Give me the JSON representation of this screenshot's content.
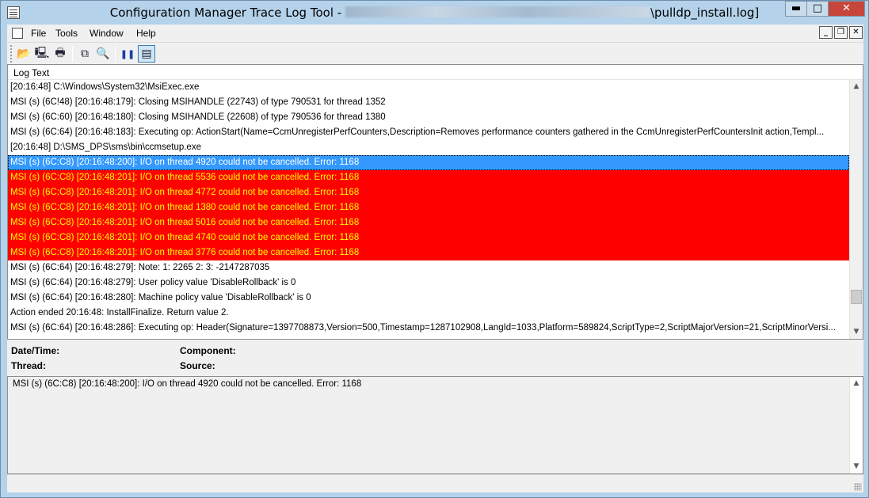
{
  "window": {
    "title_prefix": "Configuration Manager Trace Log Tool - ",
    "title_suffix": "\\pulldp_install.log]",
    "minimize": "▬",
    "maximize": "□",
    "close": "✕"
  },
  "menu": {
    "items": [
      "File",
      "Tools",
      "Window",
      "Help"
    ],
    "mdi_minimize": "_",
    "mdi_restore": "❐",
    "mdi_close": "✕"
  },
  "toolbar": {
    "open": "📂",
    "print_preview": "🖳",
    "print": "🖶",
    "copy": "⧉",
    "find": "🔍",
    "pause": "❚❚",
    "view": "▤"
  },
  "log": {
    "header": "Log Text",
    "rows": [
      {
        "text": "[20:16:48] C:\\Windows\\System32\\MsiExec.exe",
        "style": "normal"
      },
      {
        "text": "MSI (s) (6C!48) [20:16:48:179]: Closing MSIHANDLE (22743) of type 790531 for thread 1352",
        "style": "normal"
      },
      {
        "text": "MSI (s) (6C:60) [20:16:48:180]: Closing MSIHANDLE (22608) of type 790536 for thread 1380",
        "style": "normal"
      },
      {
        "text": "MSI (s) (6C:64) [20:16:48:183]: Executing op: ActionStart(Name=CcmUnregisterPerfCounters,Description=Removes performance counters gathered in the CcmUnregisterPerfCountersInit action,Templ...",
        "style": "normal"
      },
      {
        "text": "[20:16:48] D:\\SMS_DPS\\sms\\bin\\ccmsetup.exe",
        "style": "normal"
      },
      {
        "text": "MSI (s) (6C:C8) [20:16:48:200]: I/O on thread 4920 could not be cancelled. Error: 1168",
        "style": "selected"
      },
      {
        "text": "MSI (s) (6C:C8) [20:16:48:201]: I/O on thread 5536 could not be cancelled. Error: 1168",
        "style": "error"
      },
      {
        "text": "MSI (s) (6C:C8) [20:16:48:201]: I/O on thread 4772 could not be cancelled. Error: 1168",
        "style": "error"
      },
      {
        "text": "MSI (s) (6C:C8) [20:16:48:201]: I/O on thread 1380 could not be cancelled. Error: 1168",
        "style": "error"
      },
      {
        "text": "MSI (s) (6C:C8) [20:16:48:201]: I/O on thread 5016 could not be cancelled. Error: 1168",
        "style": "error"
      },
      {
        "text": "MSI (s) (6C:C8) [20:16:48:201]: I/O on thread 4740 could not be cancelled. Error: 1168",
        "style": "error"
      },
      {
        "text": "MSI (s) (6C:C8) [20:16:48:201]: I/O on thread 3776 could not be cancelled. Error: 1168",
        "style": "error"
      },
      {
        "text": "MSI (s) (6C:64) [20:16:48:279]: Note: 1: 2265 2:  3: -2147287035",
        "style": "normal"
      },
      {
        "text": "MSI (s) (6C:64) [20:16:48:279]: User policy value 'DisableRollback' is 0",
        "style": "normal"
      },
      {
        "text": "MSI (s) (6C:64) [20:16:48:280]: Machine policy value 'DisableRollback' is 0",
        "style": "normal"
      },
      {
        "text": "Action ended 20:16:48: InstallFinalize. Return value 2.",
        "style": "normal"
      },
      {
        "text": "MSI (s) (6C:64) [20:16:48:286]: Executing op: Header(Signature=1397708873,Version=500,Timestamp=1287102908,LangId=1033,Platform=589824,ScriptType=2,ScriptMajorVersion=21,ScriptMinorVersi...",
        "style": "normal"
      }
    ]
  },
  "details": {
    "datetime_label": "Date/Time:",
    "component_label": "Component:",
    "thread_label": "Thread:",
    "source_label": "Source:"
  },
  "message": {
    "text": "MSI (s) (6C:C8) [20:16:48:200]: I/O on thread 4920 could not be cancelled. Error: 1168"
  },
  "scroll": {
    "up": "▲",
    "down": "▼",
    "log_position": 0.9
  }
}
